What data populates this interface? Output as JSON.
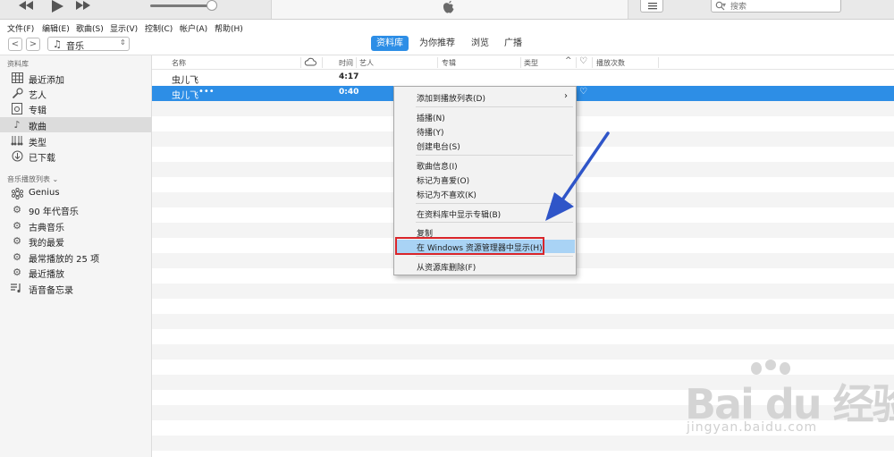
{
  "player": {
    "prev_icon": "rewind-icon",
    "play_icon": "play-icon",
    "next_icon": "fast-forward-icon",
    "volume_level": 0.92,
    "search_placeholder": "搜索"
  },
  "menubar": {
    "items": [
      "文件(F)",
      "编辑(E)",
      "歌曲(S)",
      "显示(V)",
      "控制(C)",
      "帐户(A)",
      "帮助(H)"
    ]
  },
  "nav": {
    "back": "<",
    "forward": ">",
    "media_type": "音乐",
    "tabs": [
      "资料库",
      "为你推荐",
      "浏览",
      "广播"
    ],
    "active_tab": "资料库"
  },
  "sidebar": {
    "library_header": "资料库",
    "library_items": [
      {
        "label": "最近添加",
        "icon": "grid-icon"
      },
      {
        "label": "艺人",
        "icon": "microphone-icon"
      },
      {
        "label": "专辑",
        "icon": "album-icon"
      },
      {
        "label": "歌曲",
        "icon": "music-note-icon"
      },
      {
        "label": "类型",
        "icon": "genre-icon"
      },
      {
        "label": "已下载",
        "icon": "download-icon"
      }
    ],
    "selected": "歌曲",
    "playlists_header": "音乐播放列表",
    "playlist_items": [
      {
        "label": "Genius",
        "icon": "genius-icon"
      },
      {
        "label": "90 年代音乐",
        "icon": "smart-playlist-gear-icon"
      },
      {
        "label": "古典音乐",
        "icon": "smart-playlist-gear-icon"
      },
      {
        "label": "我的最爱",
        "icon": "smart-playlist-gear-icon"
      },
      {
        "label": "最常播放的 25 项",
        "icon": "smart-playlist-gear-icon"
      },
      {
        "label": "最近播放",
        "icon": "smart-playlist-gear-icon"
      },
      {
        "label": "语音备忘录",
        "icon": "playlist-icon"
      }
    ]
  },
  "table": {
    "headers": {
      "name": "名称",
      "cloud": "cloud-icon",
      "time": "时间",
      "artist": "艺人",
      "album": "专辑",
      "genre": "类型",
      "love": "heart-icon",
      "plays": "播放次数"
    },
    "rows": [
      {
        "name": "虫儿飞",
        "time": "4:17",
        "artist": "",
        "album": "",
        "genre": "",
        "plays": ""
      },
      {
        "name": "虫儿飞",
        "time": "0:40",
        "artist": "",
        "album": "",
        "genre": "",
        "plays": ""
      }
    ],
    "selected_row_more": "•••"
  },
  "context_menu": {
    "items": [
      {
        "label": "添加到播放列表(D)",
        "submenu": true
      },
      {
        "label": "插播(N)"
      },
      {
        "label": "待播(Y)"
      },
      {
        "label": "创建电台(S)"
      },
      {
        "label": "歌曲信息(I)"
      },
      {
        "label": "标记为喜爱(O)"
      },
      {
        "label": "标记为不喜欢(K)"
      },
      {
        "label": "在资料库中显示专辑(B)"
      },
      {
        "label": "复制"
      },
      {
        "label": "在 Windows 资源管理器中显示(H)"
      },
      {
        "label": "从资源库删除(F)"
      }
    ],
    "highlighted": "在 Windows 资源管理器中显示(H)"
  },
  "colors": {
    "accent": "#2d8ee6",
    "highlight_box": "#d9252a",
    "arrow": "#2f55c8"
  },
  "watermark": {
    "brand": "Bai du 经验",
    "url": "jingyan.baidu.com"
  }
}
